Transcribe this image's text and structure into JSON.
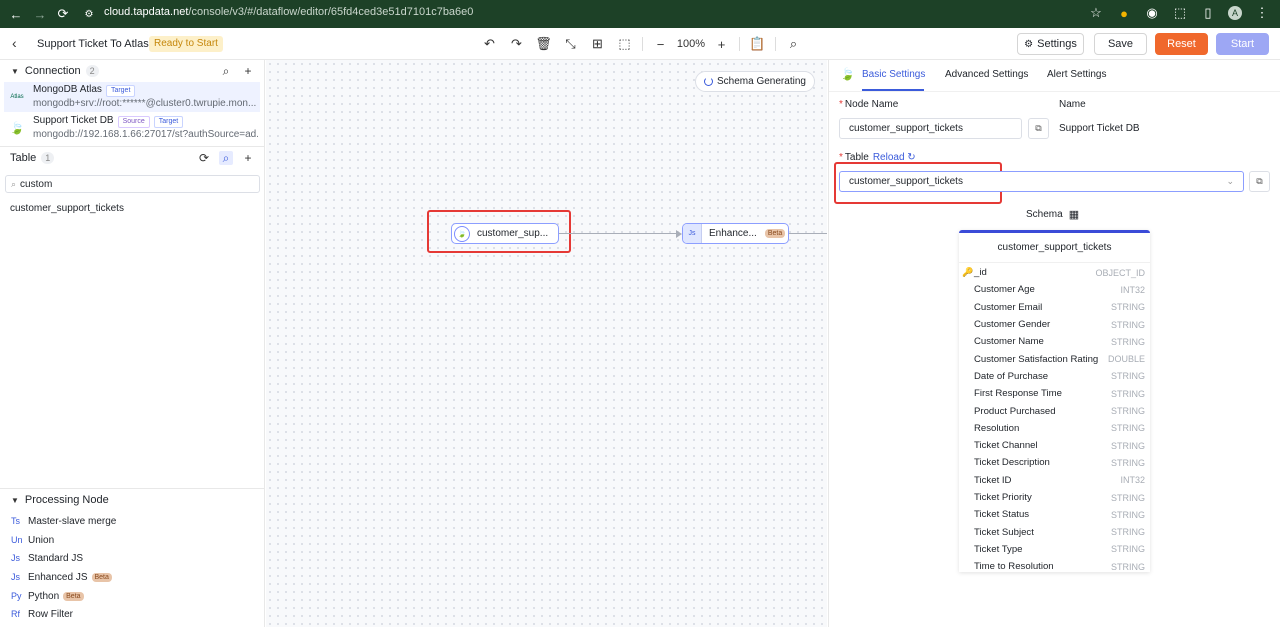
{
  "browser": {
    "url_host": "cloud.tapdata.net",
    "url_path": "/console/v3/#/dataflow/editor/65fd4ced3e51d7101c7ba6e0",
    "avatar_letter": "A"
  },
  "header": {
    "back_icon": "chevron-left-icon",
    "title": "Support Ticket To Atlas",
    "status": "Ready to Start",
    "zoom": "100%",
    "settings_label": "Settings",
    "save_label": "Save",
    "reset_label": "Reset",
    "start_label": "Start"
  },
  "left": {
    "connection_title": "Connection",
    "connection_count": "2",
    "connections": [
      {
        "name": "MongoDB Atlas",
        "tags": [
          "Target"
        ],
        "url": "mongodb+srv://root:******@cluster0.twrupie.mon..."
      },
      {
        "name": "Support Ticket DB",
        "tags": [
          "Source",
          "Target"
        ],
        "url": "mongodb://192.168.1.66:27017/st?authSource=ad..."
      }
    ],
    "table_title": "Table",
    "table_count": "1",
    "search_value": "custom",
    "tables": [
      "customer_support_tickets"
    ],
    "processing_title": "Processing Node",
    "processing": [
      {
        "abbr": "Ts",
        "label": "Master-slave merge",
        "beta": ""
      },
      {
        "abbr": "Un",
        "label": "Union",
        "beta": ""
      },
      {
        "abbr": "Js",
        "label": "Standard JS",
        "beta": ""
      },
      {
        "abbr": "Js",
        "label": "Enhanced JS",
        "beta": "Beta"
      },
      {
        "abbr": "Py",
        "label": "Python",
        "beta": "Beta"
      },
      {
        "abbr": "Rf",
        "label": "Row Filter",
        "beta": ""
      }
    ]
  },
  "canvas": {
    "schema_status": "Schema Generating",
    "node1_label": "customer_sup...",
    "node2_abbr": "Js",
    "node2_label": "Enhance...",
    "node2_beta": "Beta"
  },
  "right": {
    "tabs": [
      "Basic Settings",
      "Advanced Settings",
      "Alert Settings"
    ],
    "node_name_label": "Node Name",
    "node_name_value": "customer_support_tickets",
    "name_label": "Name",
    "name_value": "Support Ticket DB",
    "table_label": "Table",
    "reload_label": "Reload",
    "table_value": "customer_support_tickets",
    "schema_label": "Schema",
    "schema_table": "customer_support_tickets",
    "fields": [
      {
        "name": "_id",
        "type": "OBJECT_ID"
      },
      {
        "name": "Customer Age",
        "type": "INT32"
      },
      {
        "name": "Customer Email",
        "type": "STRING"
      },
      {
        "name": "Customer Gender",
        "type": "STRING"
      },
      {
        "name": "Customer Name",
        "type": "STRING"
      },
      {
        "name": "Customer Satisfaction Rating",
        "type": "DOUBLE"
      },
      {
        "name": "Date of Purchase",
        "type": "STRING"
      },
      {
        "name": "First Response Time",
        "type": "STRING"
      },
      {
        "name": "Product Purchased",
        "type": "STRING"
      },
      {
        "name": "Resolution",
        "type": "STRING"
      },
      {
        "name": "Ticket Channel",
        "type": "STRING"
      },
      {
        "name": "Ticket Description",
        "type": "STRING"
      },
      {
        "name": "Ticket ID",
        "type": "INT32"
      },
      {
        "name": "Ticket Priority",
        "type": "STRING"
      },
      {
        "name": "Ticket Status",
        "type": "STRING"
      },
      {
        "name": "Ticket Subject",
        "type": "STRING"
      },
      {
        "name": "Ticket Type",
        "type": "STRING"
      },
      {
        "name": "Time to Resolution",
        "type": "STRING"
      }
    ]
  },
  "colors": {
    "accent": "#3b5bdb",
    "reset": "#f0682c",
    "start": "#9da7f4",
    "highlight": "#e53935",
    "status_bg": "#fdf0c9"
  }
}
